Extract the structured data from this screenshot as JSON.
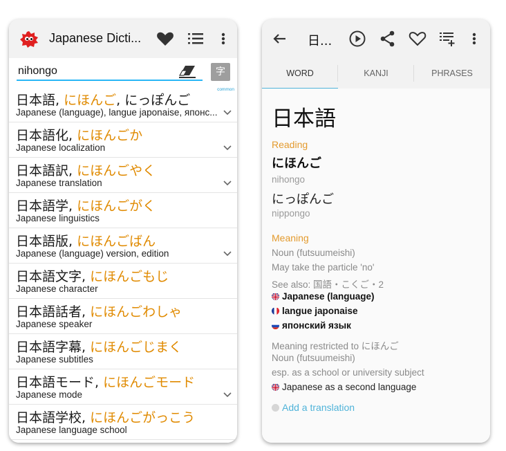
{
  "left": {
    "app_title": "Japanese Dicti...",
    "search": {
      "value": "nihongo"
    },
    "kanji_button": "字",
    "common_label": "common",
    "results": [
      {
        "kanji": "日本語",
        "kana": "にほんご",
        "extra": ", にっぽんご",
        "definition": "Japanese (language), langue japonaise, японс..."
      },
      {
        "kanji": "日本語化",
        "kana": "にほんごか",
        "definition": "Japanese localization"
      },
      {
        "kanji": "日本語訳",
        "kana": "にほんごやく",
        "definition": "Japanese translation"
      },
      {
        "kanji": "日本語学",
        "kana": "にほんごがく",
        "definition": "Japanese linguistics"
      },
      {
        "kanji": "日本語版",
        "kana": "にほんごばん",
        "definition": "Japanese (language) version, edition"
      },
      {
        "kanji": "日本語文字",
        "kana": "にほんごもじ",
        "definition": "Japanese character"
      },
      {
        "kanji": "日本語話者",
        "kana": "にほんごわしゃ",
        "definition": "Japanese speaker"
      },
      {
        "kanji": "日本語字幕",
        "kana": "にほんごじまく",
        "definition": "Japanese subtitles"
      },
      {
        "kanji": "日本語モード",
        "kana": "にほんごモード",
        "definition": "Japanese mode"
      },
      {
        "kanji": "日本語学校",
        "kana": "にほんごがっこう",
        "definition": "Japanese language school"
      }
    ]
  },
  "right": {
    "title": "日...",
    "tabs": [
      "WORD",
      "KANJI",
      "PHRASES"
    ],
    "word": "日本語",
    "reading_label": "Reading",
    "readings": [
      {
        "kana": "にほんご",
        "romaji": "nihongo"
      },
      {
        "kana": "にっぽんご",
        "romaji": "nippongo"
      }
    ],
    "meaning_label": "Meaning",
    "meaning_pos": "Noun (futsuumeishi)",
    "particle_note": "May take the particle 'no'",
    "see_also": "See also: 国語・こくご・2",
    "translations": [
      "Japanese (language)",
      "langue japonaise",
      "японский язык"
    ],
    "restricted": "Meaning restricted to にほんご",
    "restricted_pos": "Noun (futsuumeishi)",
    "restricted_note": "esp. as a school or university subject",
    "restricted_translation": "Japanese as a second language",
    "add_translation": "Add a translation",
    "colors": {
      "accent": "#4fb3d9",
      "kana": "#e08a00",
      "section": "#e39a2d"
    }
  }
}
